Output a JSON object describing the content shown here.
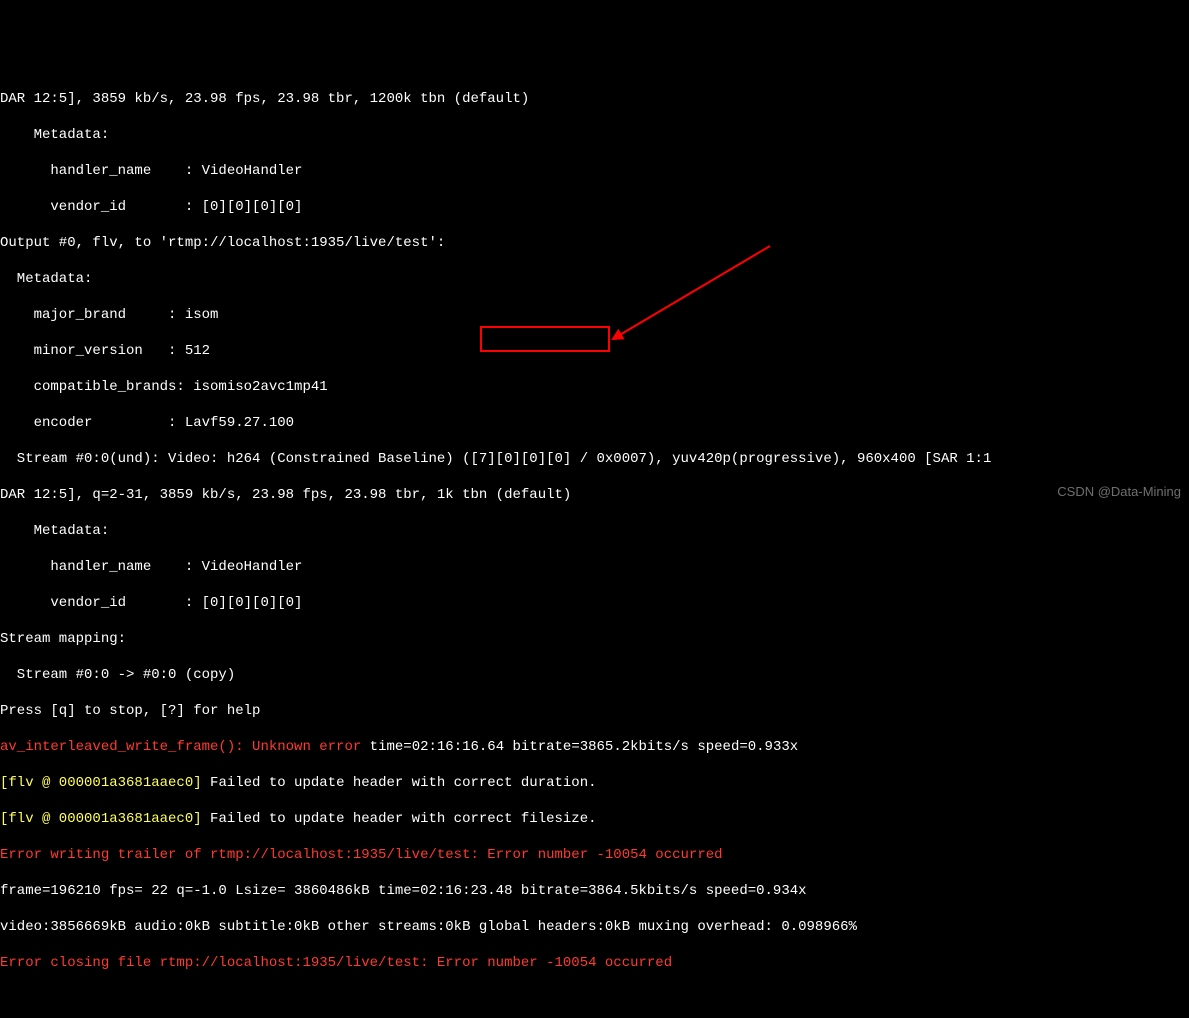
{
  "lines": {
    "l1": "DAR 12:5], 3859 kb/s, 23.98 fps, 23.98 tbr, 1200k tbn (default)",
    "l2": "    Metadata:",
    "l3": "      handler_name    : VideoHandler",
    "l4": "      vendor_id       : [0][0][0][0]",
    "l5": "Output #0, flv, to 'rtmp://localhost:1935/live/test':",
    "l6": "  Metadata:",
    "l7": "    major_brand     : isom",
    "l8": "    minor_version   : 512",
    "l9": "    compatible_brands: isomiso2avc1mp41",
    "l10": "    encoder         : Lavf59.27.100",
    "l11": "  Stream #0:0(und): Video: h264 (Constrained Baseline) ([7][0][0][0] / 0x0007), yuv420p(progressive), 960x400 [SAR 1:1",
    "l12": "DAR 12:5], q=2-31, 3859 kb/s, 23.98 fps, 23.98 tbr, 1k tbn (default)",
    "l13": "    Metadata:",
    "l14": "      handler_name    : VideoHandler",
    "l15": "      vendor_id       : [0][0][0][0]",
    "l16": "Stream mapping:",
    "l17": "  Stream #0:0 -> #0:0 (copy)",
    "l18": "Press [q] to stop, [?] for help",
    "l19a": "av_interleaved_write_frame(): Unknown error",
    "l19b": " time=",
    "l19c": "02:16:16.64",
    "l19d": " bitrate=3865.2kbits/s speed=0.933x",
    "l20a": "[flv @ 000001a3681aaec0]",
    "l20b": " Failed to update header with correct duration.",
    "l21a": "[flv @ 000001a3681aaec0]",
    "l21b": " Failed to update header with correct filesize.",
    "l22": "Error writing trailer of rtmp://localhost:1935/live/test: Error number -10054 occurred",
    "l23": "frame=196210 fps= 22 q=-1.0 Lsize= 3860486kB time=02:16:23.48 bitrate=3864.5kbits/s speed=0.934x",
    "l24": "video:3856669kB audio:0kB subtitle:0kB other streams:0kB global headers:0kB muxing overhead: 0.098966%",
    "l25": "Error closing file rtmp://localhost:1935/live/test: Error number -10054 occurred"
  },
  "watermark": "CSDN @Data-Mining"
}
